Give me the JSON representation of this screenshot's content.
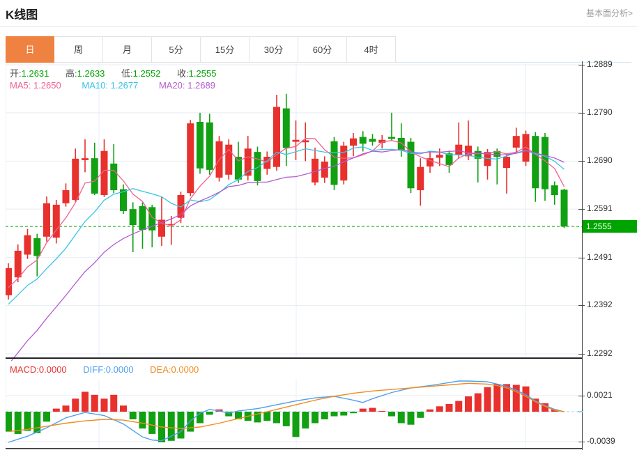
{
  "header": {
    "title": "K线图",
    "link": "基本面分析>"
  },
  "tabs": [
    {
      "label": "日",
      "active": true
    },
    {
      "label": "周",
      "active": false
    },
    {
      "label": "月",
      "active": false
    },
    {
      "label": "5分",
      "active": false
    },
    {
      "label": "15分",
      "active": false
    },
    {
      "label": "30分",
      "active": false
    },
    {
      "label": "60分",
      "active": false
    },
    {
      "label": "4时",
      "active": false
    }
  ],
  "ohlc_legend": {
    "open_label": "开:",
    "open": "1.2631",
    "high_label": "高:",
    "high": "1.2633",
    "low_label": "低:",
    "low": "1.2552",
    "close_label": "收:",
    "close": "1.2555"
  },
  "ma_legend": {
    "ma5_label": "MA5:",
    "ma5": "1.2650",
    "ma10_label": "MA10:",
    "ma10": "1.2677",
    "ma20_label": "MA20:",
    "ma20": "1.2689"
  },
  "macd_legend": {
    "macd_label": "MACD:",
    "macd": "0.0000",
    "diff_label": "DIFF:",
    "diff": "0.0000",
    "dea_label": "DEA:",
    "dea": "0.0000"
  },
  "price_axis": {
    "ticks": [
      1.2889,
      1.279,
      1.269,
      1.2591,
      1.2491,
      1.2392,
      1.2292
    ],
    "current": "1.2555"
  },
  "macd_axis": {
    "ticks": [
      0.0021,
      -0.0039
    ]
  },
  "colors": {
    "up": "#e8302d",
    "down": "#11a011",
    "ma5": "#f1608c",
    "ma10": "#38c5e8",
    "ma20": "#b35ad0",
    "diff": "#4d9ff0",
    "dea": "#f08c1e",
    "grid": "#e7eef4",
    "zero_dash": "#9bd3ea",
    "tag": "#00a400",
    "axis_dark": "#141414",
    "active_tab": "#ef8240"
  },
  "chart_data": {
    "type": "candlestick+macd",
    "main": {
      "title": "K线图 日线",
      "ylim": [
        1.2292,
        1.2889
      ],
      "current_price": 1.2555,
      "grid_vlines_x": [
        134,
        417,
        746
      ],
      "candles": [
        [
          1.2413,
          1.2479,
          1.2404,
          1.2469
        ],
        [
          1.245,
          1.2518,
          1.244,
          1.2505
        ],
        [
          1.2497,
          1.255,
          1.2488,
          1.2537
        ],
        [
          1.2531,
          1.254,
          1.2452,
          1.2494
        ],
        [
          1.2534,
          1.2617,
          1.2524,
          1.2603
        ],
        [
          1.2532,
          1.261,
          1.252,
          1.26
        ],
        [
          1.2603,
          1.2644,
          1.2596,
          1.263
        ],
        [
          1.261,
          1.2716,
          1.2606,
          1.2695
        ],
        [
          1.2692,
          1.2735,
          1.2667,
          1.2696
        ],
        [
          1.2696,
          1.2728,
          1.262,
          1.2623
        ],
        [
          1.262,
          1.2735,
          1.2616,
          1.2711
        ],
        [
          1.2685,
          1.2725,
          1.2624,
          1.263
        ],
        [
          1.2632,
          1.2642,
          1.2581,
          1.2587
        ],
        [
          1.2591,
          1.2605,
          1.2502,
          1.2558
        ],
        [
          1.2597,
          1.2605,
          1.2509,
          1.2548
        ],
        [
          1.2595,
          1.26,
          1.2512,
          1.2547
        ],
        [
          1.2534,
          1.2616,
          1.2515,
          1.2569
        ],
        [
          1.2558,
          1.2577,
          1.2517,
          1.256
        ],
        [
          1.2573,
          1.2627,
          1.2562,
          1.262
        ],
        [
          1.2624,
          1.2775,
          1.2618,
          1.2768
        ],
        [
          1.2771,
          1.279,
          1.2664,
          1.2675
        ],
        [
          1.277,
          1.2788,
          1.2662,
          1.2672
        ],
        [
          1.2656,
          1.2742,
          1.2648,
          1.2731
        ],
        [
          1.2662,
          1.2735,
          1.2652,
          1.2724
        ],
        [
          1.2699,
          1.273,
          1.2645,
          1.2652
        ],
        [
          1.266,
          1.2742,
          1.265,
          1.2716
        ],
        [
          1.2709,
          1.272,
          1.264,
          1.2649
        ],
        [
          1.2674,
          1.271,
          1.2662,
          1.2699
        ],
        [
          1.2678,
          1.2827,
          1.267,
          1.2802
        ],
        [
          1.2799,
          1.2829,
          1.268,
          1.2717
        ],
        [
          1.273,
          1.2774,
          1.2692,
          1.2734
        ],
        [
          1.2729,
          1.277,
          1.269,
          1.2733
        ],
        [
          1.2646,
          1.2718,
          1.264,
          1.2695
        ],
        [
          1.2656,
          1.27,
          1.2645,
          1.2689
        ],
        [
          1.2731,
          1.274,
          1.263,
          1.2641
        ],
        [
          1.265,
          1.273,
          1.2642,
          1.2722
        ],
        [
          1.2722,
          1.2748,
          1.27,
          1.2737
        ],
        [
          1.274,
          1.2752,
          1.271,
          1.2726
        ],
        [
          1.2736,
          1.2746,
          1.2722,
          1.273
        ],
        [
          1.2728,
          1.2744,
          1.2716,
          1.2734
        ],
        [
          1.274,
          1.279,
          1.2732,
          1.2736
        ],
        [
          1.2738,
          1.2768,
          1.2699,
          1.2713
        ],
        [
          1.273,
          1.2738,
          1.2624,
          1.2634
        ],
        [
          1.263,
          1.2696,
          1.2598,
          1.2678
        ],
        [
          1.2679,
          1.2709,
          1.2666,
          1.2696
        ],
        [
          1.2697,
          1.2716,
          1.268,
          1.2703
        ],
        [
          1.2706,
          1.2712,
          1.2666,
          1.2682
        ],
        [
          1.2702,
          1.277,
          1.2695,
          1.2724
        ],
        [
          1.27,
          1.2774,
          1.2692,
          1.2722
        ],
        [
          1.2711,
          1.272,
          1.2646,
          1.2695
        ],
        [
          1.268,
          1.2715,
          1.2652,
          1.2709
        ],
        [
          1.2711,
          1.2716,
          1.2642,
          1.2699
        ],
        [
          1.2676,
          1.2706,
          1.2623,
          1.2699
        ],
        [
          1.2718,
          1.2759,
          1.2708,
          1.2742
        ],
        [
          1.2689,
          1.2753,
          1.268,
          1.2746
        ],
        [
          1.2742,
          1.275,
          1.2606,
          1.2634
        ],
        [
          1.274,
          1.2748,
          1.2608,
          1.2632
        ],
        [
          1.264,
          1.2648,
          1.26,
          1.262
        ],
        [
          1.2631,
          1.2633,
          1.2552,
          1.2555
        ]
      ],
      "ma_periods": [
        5,
        10,
        20
      ],
      "ma_history_closes": [
        1.198,
        1.201,
        1.204,
        1.207,
        1.21,
        1.213,
        1.216,
        1.219,
        1.222,
        1.225,
        1.228,
        1.231,
        1.234,
        1.2365,
        1.2385,
        1.24,
        1.241,
        1.2418,
        1.2422,
        1.2425
      ]
    },
    "macd": {
      "ylim": [
        -0.005,
        0.0042
      ],
      "histogram": [
        -0.0026,
        -0.0029,
        -0.0025,
        -0.0028,
        -0.0013,
        0.0004,
        0.0008,
        0.0017,
        0.0026,
        0.0022,
        0.0017,
        0.0022,
        0.0008,
        -0.001,
        -0.0022,
        -0.0029,
        -0.004,
        -0.0038,
        -0.0035,
        -0.0026,
        -0.0015,
        -0.0004,
        0.0003,
        -0.0006,
        -0.001,
        -0.0012,
        -0.0014,
        -0.0012,
        -0.0015,
        -0.0019,
        -0.0033,
        -0.0022,
        -0.0015,
        -0.001,
        -0.0006,
        -0.0005,
        -0.0002,
        0.0004,
        0.0005,
        0.0001,
        -0.0006,
        -0.0015,
        -0.0017,
        -0.0008,
        0.0003,
        0.0007,
        0.001,
        0.0014,
        0.002,
        0.0024,
        0.0032,
        0.0036,
        0.0036,
        0.0035,
        0.0033,
        0.0017,
        0.0011,
        0.0003,
        0.0
      ],
      "diff": [
        [
          0,
          -0.004
        ],
        [
          2,
          -0.0032
        ],
        [
          4,
          -0.0021
        ],
        [
          6,
          -0.0008
        ],
        [
          8,
          -0.0001
        ],
        [
          10,
          -0.0005
        ],
        [
          12,
          -0.0016
        ],
        [
          14,
          -0.0033
        ],
        [
          15,
          -0.0037
        ],
        [
          16,
          -0.0038
        ],
        [
          18,
          -0.0026
        ],
        [
          19,
          -0.0012
        ],
        [
          20,
          -0.0002
        ],
        [
          21,
          0.0003
        ],
        [
          22,
          0.0001
        ],
        [
          23,
          -0.0002
        ],
        [
          24,
          0.0001
        ],
        [
          26,
          0.0004
        ],
        [
          28,
          0.0009
        ],
        [
          30,
          0.0014
        ],
        [
          32,
          0.0018
        ],
        [
          34,
          0.002
        ],
        [
          36,
          0.0015
        ],
        [
          37,
          0.0012
        ],
        [
          38,
          0.0017
        ],
        [
          40,
          0.0025
        ],
        [
          42,
          0.0031
        ],
        [
          44,
          0.0034
        ],
        [
          46,
          0.0038
        ],
        [
          47,
          0.004
        ],
        [
          48,
          0.004
        ],
        [
          50,
          0.0039
        ],
        [
          52,
          0.0033
        ],
        [
          53,
          0.0028
        ],
        [
          54,
          0.0022
        ],
        [
          55,
          0.0014
        ],
        [
          56,
          0.0008
        ],
        [
          57,
          0.0003
        ],
        [
          58,
          0.0
        ]
      ],
      "dea": [
        [
          0,
          -0.0026
        ],
        [
          2,
          -0.0023
        ],
        [
          4,
          -0.0019
        ],
        [
          6,
          -0.0015
        ],
        [
          8,
          -0.0012
        ],
        [
          10,
          -0.001
        ],
        [
          12,
          -0.0011
        ],
        [
          14,
          -0.0015
        ],
        [
          16,
          -0.002
        ],
        [
          18,
          -0.0022
        ],
        [
          20,
          -0.002
        ],
        [
          22,
          -0.0015
        ],
        [
          24,
          -0.0009
        ],
        [
          26,
          -0.0003
        ],
        [
          28,
          0.0003
        ],
        [
          30,
          0.0009
        ],
        [
          32,
          0.0015
        ],
        [
          34,
          0.002
        ],
        [
          36,
          0.0024
        ],
        [
          38,
          0.0027
        ],
        [
          40,
          0.0029
        ],
        [
          42,
          0.0031
        ],
        [
          44,
          0.0033
        ],
        [
          46,
          0.0035
        ],
        [
          48,
          0.0037
        ],
        [
          50,
          0.0036
        ],
        [
          51,
          0.0034
        ],
        [
          52,
          0.0031
        ],
        [
          53,
          0.0026
        ],
        [
          54,
          0.002
        ],
        [
          55,
          0.0013
        ],
        [
          56,
          0.0007
        ],
        [
          57,
          0.0002
        ],
        [
          58,
          0.0
        ]
      ]
    }
  }
}
